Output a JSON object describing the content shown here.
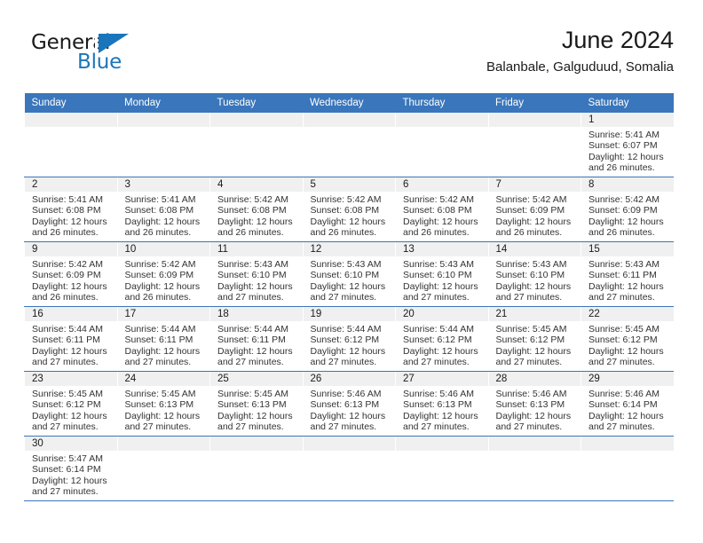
{
  "brand": {
    "name_top": "General",
    "name_bottom": "Blue",
    "accent_color": "#1b75bb"
  },
  "header": {
    "title": "June 2024",
    "subtitle": "Balanbale, Galguduud, Somalia"
  },
  "theme": {
    "header_row_bg": "#3a76bb",
    "daynum_bg": "#f0f0f0",
    "row_border": "#3a76bb",
    "text": "#333333"
  },
  "weekdays": [
    "Sunday",
    "Monday",
    "Tuesday",
    "Wednesday",
    "Thursday",
    "Friday",
    "Saturday"
  ],
  "weeks": [
    [
      {
        "day": "",
        "sunrise": "",
        "sunset": "",
        "daylight": "",
        "empty": true
      },
      {
        "day": "",
        "sunrise": "",
        "sunset": "",
        "daylight": "",
        "empty": true
      },
      {
        "day": "",
        "sunrise": "",
        "sunset": "",
        "daylight": "",
        "empty": true
      },
      {
        "day": "",
        "sunrise": "",
        "sunset": "",
        "daylight": "",
        "empty": true
      },
      {
        "day": "",
        "sunrise": "",
        "sunset": "",
        "daylight": "",
        "empty": true
      },
      {
        "day": "",
        "sunrise": "",
        "sunset": "",
        "daylight": "",
        "empty": true
      },
      {
        "day": "1",
        "sunrise": "Sunrise: 5:41 AM",
        "sunset": "Sunset: 6:07 PM",
        "daylight": "Daylight: 12 hours and 26 minutes."
      }
    ],
    [
      {
        "day": "2",
        "sunrise": "Sunrise: 5:41 AM",
        "sunset": "Sunset: 6:08 PM",
        "daylight": "Daylight: 12 hours and 26 minutes."
      },
      {
        "day": "3",
        "sunrise": "Sunrise: 5:41 AM",
        "sunset": "Sunset: 6:08 PM",
        "daylight": "Daylight: 12 hours and 26 minutes."
      },
      {
        "day": "4",
        "sunrise": "Sunrise: 5:42 AM",
        "sunset": "Sunset: 6:08 PM",
        "daylight": "Daylight: 12 hours and 26 minutes."
      },
      {
        "day": "5",
        "sunrise": "Sunrise: 5:42 AM",
        "sunset": "Sunset: 6:08 PM",
        "daylight": "Daylight: 12 hours and 26 minutes."
      },
      {
        "day": "6",
        "sunrise": "Sunrise: 5:42 AM",
        "sunset": "Sunset: 6:08 PM",
        "daylight": "Daylight: 12 hours and 26 minutes."
      },
      {
        "day": "7",
        "sunrise": "Sunrise: 5:42 AM",
        "sunset": "Sunset: 6:09 PM",
        "daylight": "Daylight: 12 hours and 26 minutes."
      },
      {
        "day": "8",
        "sunrise": "Sunrise: 5:42 AM",
        "sunset": "Sunset: 6:09 PM",
        "daylight": "Daylight: 12 hours and 26 minutes."
      }
    ],
    [
      {
        "day": "9",
        "sunrise": "Sunrise: 5:42 AM",
        "sunset": "Sunset: 6:09 PM",
        "daylight": "Daylight: 12 hours and 26 minutes."
      },
      {
        "day": "10",
        "sunrise": "Sunrise: 5:42 AM",
        "sunset": "Sunset: 6:09 PM",
        "daylight": "Daylight: 12 hours and 26 minutes."
      },
      {
        "day": "11",
        "sunrise": "Sunrise: 5:43 AM",
        "sunset": "Sunset: 6:10 PM",
        "daylight": "Daylight: 12 hours and 27 minutes."
      },
      {
        "day": "12",
        "sunrise": "Sunrise: 5:43 AM",
        "sunset": "Sunset: 6:10 PM",
        "daylight": "Daylight: 12 hours and 27 minutes."
      },
      {
        "day": "13",
        "sunrise": "Sunrise: 5:43 AM",
        "sunset": "Sunset: 6:10 PM",
        "daylight": "Daylight: 12 hours and 27 minutes."
      },
      {
        "day": "14",
        "sunrise": "Sunrise: 5:43 AM",
        "sunset": "Sunset: 6:10 PM",
        "daylight": "Daylight: 12 hours and 27 minutes."
      },
      {
        "day": "15",
        "sunrise": "Sunrise: 5:43 AM",
        "sunset": "Sunset: 6:11 PM",
        "daylight": "Daylight: 12 hours and 27 minutes."
      }
    ],
    [
      {
        "day": "16",
        "sunrise": "Sunrise: 5:44 AM",
        "sunset": "Sunset: 6:11 PM",
        "daylight": "Daylight: 12 hours and 27 minutes."
      },
      {
        "day": "17",
        "sunrise": "Sunrise: 5:44 AM",
        "sunset": "Sunset: 6:11 PM",
        "daylight": "Daylight: 12 hours and 27 minutes."
      },
      {
        "day": "18",
        "sunrise": "Sunrise: 5:44 AM",
        "sunset": "Sunset: 6:11 PM",
        "daylight": "Daylight: 12 hours and 27 minutes."
      },
      {
        "day": "19",
        "sunrise": "Sunrise: 5:44 AM",
        "sunset": "Sunset: 6:12 PM",
        "daylight": "Daylight: 12 hours and 27 minutes."
      },
      {
        "day": "20",
        "sunrise": "Sunrise: 5:44 AM",
        "sunset": "Sunset: 6:12 PM",
        "daylight": "Daylight: 12 hours and 27 minutes."
      },
      {
        "day": "21",
        "sunrise": "Sunrise: 5:45 AM",
        "sunset": "Sunset: 6:12 PM",
        "daylight": "Daylight: 12 hours and 27 minutes."
      },
      {
        "day": "22",
        "sunrise": "Sunrise: 5:45 AM",
        "sunset": "Sunset: 6:12 PM",
        "daylight": "Daylight: 12 hours and 27 minutes."
      }
    ],
    [
      {
        "day": "23",
        "sunrise": "Sunrise: 5:45 AM",
        "sunset": "Sunset: 6:12 PM",
        "daylight": "Daylight: 12 hours and 27 minutes."
      },
      {
        "day": "24",
        "sunrise": "Sunrise: 5:45 AM",
        "sunset": "Sunset: 6:13 PM",
        "daylight": "Daylight: 12 hours and 27 minutes."
      },
      {
        "day": "25",
        "sunrise": "Sunrise: 5:45 AM",
        "sunset": "Sunset: 6:13 PM",
        "daylight": "Daylight: 12 hours and 27 minutes."
      },
      {
        "day": "26",
        "sunrise": "Sunrise: 5:46 AM",
        "sunset": "Sunset: 6:13 PM",
        "daylight": "Daylight: 12 hours and 27 minutes."
      },
      {
        "day": "27",
        "sunrise": "Sunrise: 5:46 AM",
        "sunset": "Sunset: 6:13 PM",
        "daylight": "Daylight: 12 hours and 27 minutes."
      },
      {
        "day": "28",
        "sunrise": "Sunrise: 5:46 AM",
        "sunset": "Sunset: 6:13 PM",
        "daylight": "Daylight: 12 hours and 27 minutes."
      },
      {
        "day": "29",
        "sunrise": "Sunrise: 5:46 AM",
        "sunset": "Sunset: 6:14 PM",
        "daylight": "Daylight: 12 hours and 27 minutes."
      }
    ],
    [
      {
        "day": "30",
        "sunrise": "Sunrise: 5:47 AM",
        "sunset": "Sunset: 6:14 PM",
        "daylight": "Daylight: 12 hours and 27 minutes."
      },
      {
        "day": "",
        "sunrise": "",
        "sunset": "",
        "daylight": "",
        "empty": true
      },
      {
        "day": "",
        "sunrise": "",
        "sunset": "",
        "daylight": "",
        "empty": true
      },
      {
        "day": "",
        "sunrise": "",
        "sunset": "",
        "daylight": "",
        "empty": true
      },
      {
        "day": "",
        "sunrise": "",
        "sunset": "",
        "daylight": "",
        "empty": true
      },
      {
        "day": "",
        "sunrise": "",
        "sunset": "",
        "daylight": "",
        "empty": true
      },
      {
        "day": "",
        "sunrise": "",
        "sunset": "",
        "daylight": "",
        "empty": true
      }
    ]
  ]
}
